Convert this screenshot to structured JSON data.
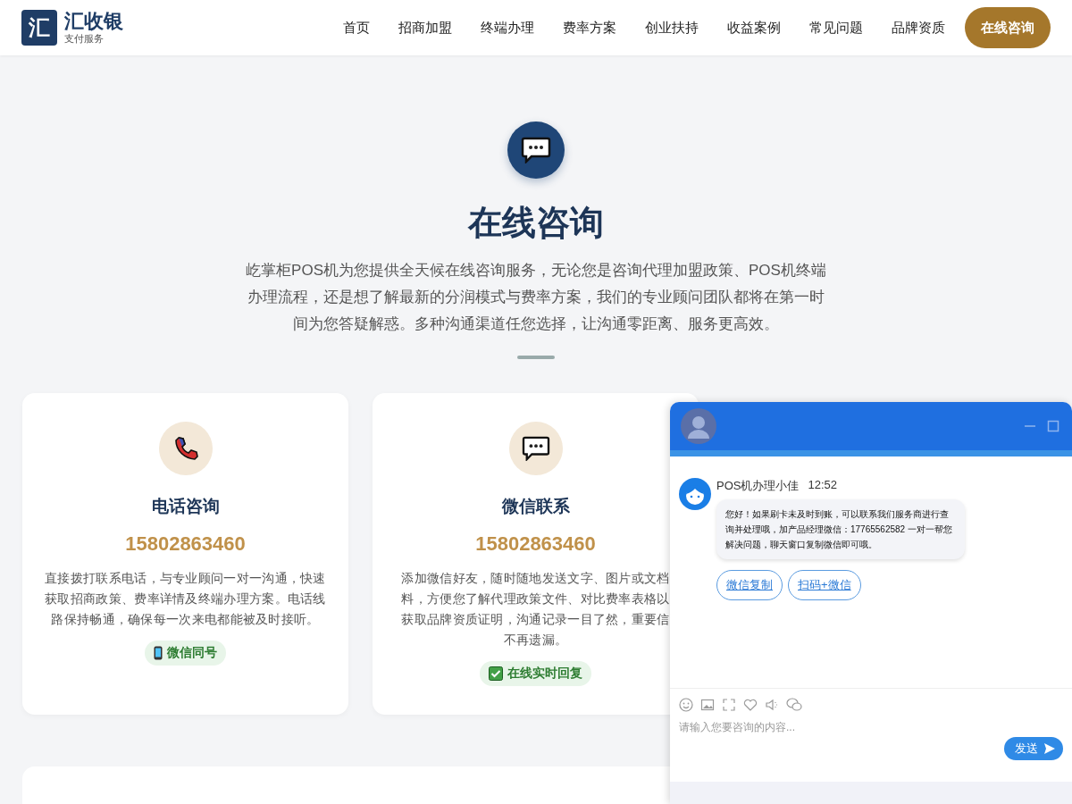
{
  "header": {
    "logo_mark": "汇",
    "brand": "汇收银",
    "tagline": "支付服务",
    "nav": [
      {
        "label": "首页"
      },
      {
        "label": "招商加盟"
      },
      {
        "label": "终端办理"
      },
      {
        "label": "费率方案"
      },
      {
        "label": "创业扶持"
      },
      {
        "label": "收益案例"
      },
      {
        "label": "常见问题"
      },
      {
        "label": "品牌资质"
      }
    ],
    "cta": "在线咨询"
  },
  "hero": {
    "title": "在线咨询",
    "description": "屹掌柜POS机为您提供全天候在线咨询服务，无论您是咨询代理加盟政策、POS机终端办理流程，还是想了解最新的分润模式与费率方案，我们的专业顾问团队都将在第一时间为您答疑解惑。多种沟通渠道任您选择，让沟通零距离、服务更高效。"
  },
  "cards": [
    {
      "kind": "phone",
      "title": "电话咨询",
      "number": "15802863460",
      "description_lines": [
        "直接拨打联系电话，与专业顾问一对一沟通，快速",
        "获取招商政策、费率详情及终端办理方案。电话线",
        "路保持畅通，确保每一次来电都能被及时接听。"
      ],
      "badge": {
        "kind": "mobile",
        "label": "微信同号"
      }
    },
    {
      "kind": "chat",
      "title": "微信联系",
      "number": "15802863460",
      "description_lines": [
        "添加微信好友，随时随地发送文字、图片或文档",
        "料，方便您了解代理政策文件、对比费率表格以",
        "获取品牌资质证明，沟通记录一目了然，重要信",
        "不再遗漏。"
      ],
      "badge": {
        "kind": "check",
        "label": "在线实时回复"
      }
    }
  ],
  "chat_window": {
    "messages": [
      {
        "sender": "POS机办理小佳",
        "time": "12:52",
        "text": "您好！如果刷卡未及时到账，可以联系我们服务商进行查询并处理哦，加产品经理微信：17765562582 一对一帮您解决问题，聊天窗口复制微信即可哦。",
        "actions": [
          "微信复制",
          "扫码+微信"
        ]
      }
    ],
    "input": {
      "placeholder": "请输入您要咨询的内容..."
    },
    "send": "发送"
  }
}
